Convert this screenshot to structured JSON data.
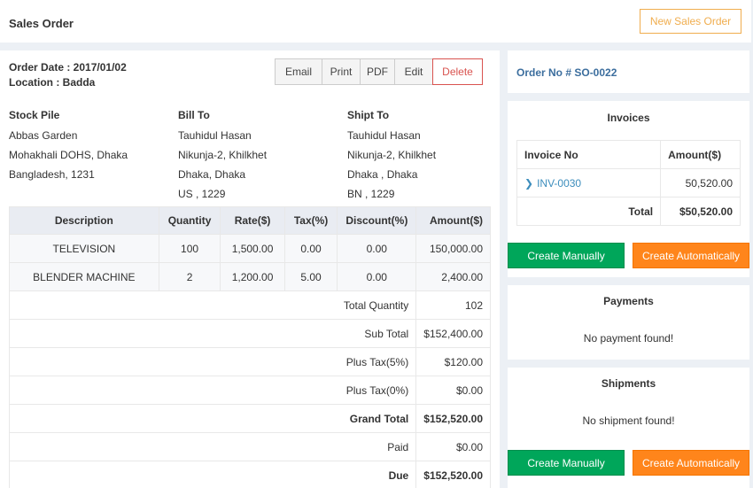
{
  "header": {
    "title": "Sales Order",
    "new_button": "New Sales Order"
  },
  "order": {
    "date_label": "Order Date : 2017/01/02",
    "location_label": "Location : Badda"
  },
  "actions": {
    "email": "Email",
    "print": "Print",
    "pdf": "PDF",
    "edit": "Edit",
    "delete": "Delete"
  },
  "addresses": {
    "stock_pile": {
      "heading": "Stock Pile",
      "lines": [
        "Abbas Garden",
        "Mohakhali DOHS, Dhaka",
        "Bangladesh, 1231"
      ]
    },
    "bill_to": {
      "heading": "Bill To",
      "lines": [
        "Tauhidul Hasan",
        "Nikunja-2, Khilkhet",
        "Dhaka, Dhaka",
        "US , 1229"
      ]
    },
    "ship_to": {
      "heading": "Shipt To",
      "lines": [
        "Tauhidul Hasan",
        "Nikunja-2, Khilkhet",
        "Dhaka , Dhaka",
        "BN , 1229"
      ]
    }
  },
  "items": {
    "columns": [
      "Description",
      "Quantity",
      "Rate($)",
      "Tax(%)",
      "Discount(%)",
      "Amount($)"
    ],
    "rows": [
      {
        "description": "TELEVISION",
        "quantity": "100",
        "rate": "1,500.00",
        "tax": "0.00",
        "discount": "0.00",
        "amount": "150,000.00"
      },
      {
        "description": "BLENDER MACHINE",
        "quantity": "2",
        "rate": "1,200.00",
        "tax": "5.00",
        "discount": "0.00",
        "amount": "2,400.00"
      }
    ],
    "summary": [
      {
        "label": "Total Quantity",
        "value": "102",
        "bold": false
      },
      {
        "label": "Sub Total",
        "value": "$152,400.00",
        "bold": false
      },
      {
        "label": "Plus Tax(5%)",
        "value": "$120.00",
        "bold": false
      },
      {
        "label": "Plus Tax(0%)",
        "value": "$0.00",
        "bold": false
      },
      {
        "label": "Grand Total",
        "value": "$152,520.00",
        "bold": true
      },
      {
        "label": "Paid",
        "value": "$0.00",
        "bold": false
      },
      {
        "label": "Due",
        "value": "$152,520.00",
        "bold": true
      }
    ]
  },
  "sidebar": {
    "order_no": "Order No # SO-0022",
    "invoices": {
      "title": "Invoices",
      "columns": [
        "Invoice No",
        "Amount($)"
      ],
      "rows": [
        {
          "invoice_no": "INV-0030",
          "amount": "50,520.00"
        }
      ],
      "total_label": "Total",
      "total_value": "$50,520.00",
      "create_manually": "Create Manually",
      "create_automatically": "Create Automatically"
    },
    "payments": {
      "title": "Payments",
      "empty": "No payment found!"
    },
    "shipments": {
      "title": "Shipments",
      "empty": "No shipment found!",
      "create_manually": "Create Manually",
      "create_automatically": "Create Automatically"
    }
  },
  "colors": {
    "accent": "#3c8dbc",
    "green": "#00a65a",
    "orange": "#ff851b",
    "danger": "#d9534f",
    "warning": "#f0ad4e"
  }
}
